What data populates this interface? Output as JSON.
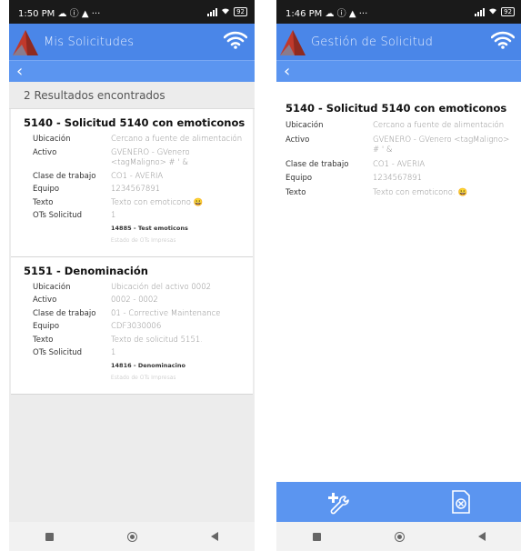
{
  "left": {
    "status": {
      "time": "1:50 PM",
      "icons": "☁ ⓘ ▲ ···",
      "battery": "92"
    },
    "appbar": {
      "title": "Mis Solicitudes"
    },
    "results_text": "2 Resultados encontrados",
    "cards": [
      {
        "title": "5140 - Solicitud 5140 con emoticonos",
        "ubicacion_label": "Ubicación",
        "ubicacion": "Cercano a fuente de alimentación",
        "activo_label": "Activo",
        "activo": "GVENERO - GVenero <tagMaligno> # ' &",
        "clase_label": "Clase de trabajo",
        "clase": "CO1 - AVERIA",
        "equipo_label": "Equipo",
        "equipo": "1234567891",
        "texto_label": "Texto",
        "texto": "Texto con emoticono",
        "texto_emoji": "😀",
        "ots_label": "OTs Solicitud",
        "ots_count": "1",
        "ot_item": "14885 - Test emoticons",
        "ot_state": "Estado de OTs Impresas"
      },
      {
        "title": "5151 - Denominación",
        "ubicacion_label": "Ubicación",
        "ubicacion": "Ubicación del activo 0002",
        "activo_label": "Activo",
        "activo": "0002 - 0002",
        "clase_label": "Clase de trabajo",
        "clase": "01 - Corrective Maintenance",
        "equipo_label": "Equipo",
        "equipo": "CDF3030006",
        "texto_label": "Texto",
        "texto": "Texto de solicitud 5151.",
        "ots_label": "OTs Solicitud",
        "ots_count": "1",
        "ot_item": "14816 - Denominacino",
        "ot_state": "Estado de OTs Impresas"
      }
    ]
  },
  "right": {
    "status": {
      "time": "1:46 PM",
      "icons": "☁ ⓘ ▲ ···",
      "battery": "92"
    },
    "appbar": {
      "title": "Gestión de Solicitud"
    },
    "detail": {
      "title": "5140 - Solicitud 5140 con emoticonos",
      "ubicacion_label": "Ubicación",
      "ubicacion": "Cercano a fuente de alimentación",
      "activo_label": "Activo",
      "activo": "GVENERO - GVenero <tagMaligno> # ' &",
      "clase_label": "Clase de trabajo",
      "clase": "CO1 - AVERIA",
      "equipo_label": "Equipo",
      "equipo": "1234567891",
      "texto_label": "Texto",
      "texto": "Texto con emoticono:",
      "texto_emoji": "😀"
    }
  },
  "icons": {
    "back": "‹",
    "wifi": "wifi-icon",
    "add_tool": "add-wrench-icon",
    "cancel": "cancel-doc-icon"
  },
  "colors": {
    "appbar": "#4a86e8",
    "backbar": "#5b95f0",
    "logo": "#c0392b"
  }
}
